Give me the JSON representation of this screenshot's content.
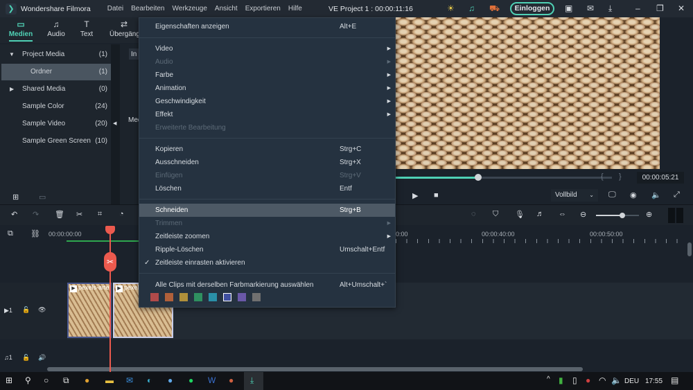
{
  "titlebar": {
    "app_name": "Wondershare Filmora",
    "menus": [
      "Datei",
      "Bearbeiten",
      "Werkzeuge",
      "Ansicht",
      "Exportieren",
      "Hilfe"
    ],
    "project_title": "VE Project 1 : 00:00:11:16",
    "login_label": "Einloggen"
  },
  "tabs": [
    {
      "label": "Medien",
      "icon": "folder-icon",
      "active": true
    },
    {
      "label": "Audio",
      "icon": "music-note-icon"
    },
    {
      "label": "Text",
      "icon": "text-icon"
    },
    {
      "label": "Übergäng",
      "icon": "transition-icon"
    }
  ],
  "media_tree": [
    {
      "label": "Project Media",
      "count": "(1)",
      "expanded": true
    },
    {
      "label": "Ordner",
      "count": "(1)",
      "selected": true
    },
    {
      "label": "Shared Media",
      "count": "(0)"
    },
    {
      "label": "Sample Color",
      "count": "(24)"
    },
    {
      "label": "Sample Video",
      "count": "(20)"
    },
    {
      "label": "Sample Green Screen",
      "count": "(10)"
    }
  ],
  "media_area": {
    "button_partial": "In",
    "label_partial": "Med"
  },
  "context_menu": {
    "items": [
      {
        "label": "Eigenschaften anzeigen",
        "shortcut": "Alt+E"
      },
      {
        "label": "Video",
        "submenu": true
      },
      {
        "label": "Audio",
        "submenu": true,
        "disabled": true
      },
      {
        "label": "Farbe",
        "submenu": true
      },
      {
        "label": "Animation",
        "submenu": true
      },
      {
        "label": "Geschwindigkeit",
        "submenu": true
      },
      {
        "label": "Effekt",
        "submenu": true
      },
      {
        "label": "Erweiterte Bearbeitung",
        "disabled": true
      },
      {
        "label": "Kopieren",
        "shortcut": "Strg+C"
      },
      {
        "label": "Ausschneiden",
        "shortcut": "Strg+X"
      },
      {
        "label": "Einfügen",
        "shortcut": "Strg+V",
        "disabled": true
      },
      {
        "label": "Löschen",
        "shortcut": "Entf"
      },
      {
        "label": "Schneiden",
        "shortcut": "Strg+B",
        "highlighted": true
      },
      {
        "label": "Trimmen",
        "submenu": true,
        "disabled": true
      },
      {
        "label": "Zeitleiste zoomen",
        "submenu": true
      },
      {
        "label": "Ripple-Löschen",
        "shortcut": "Umschalt+Entf"
      },
      {
        "label": "Zeitleiste einrasten aktivieren",
        "checked": true
      },
      {
        "label": "Alle Clips mit derselben Farbmarkierung auswählen",
        "shortcut": "Alt+Umschalt+`"
      }
    ],
    "color_swatches": [
      "#b04a4a",
      "#b0603a",
      "#b0903a",
      "#2f9060",
      "#2a90a8",
      "#4050a0",
      "#6a58a8",
      "#707070"
    ],
    "selected_swatch": 5
  },
  "preview": {
    "progress_percent": 38,
    "timecode": "00:00:05:21",
    "quality": "Vollbild",
    "brace_open": "{",
    "brace_close": "}"
  },
  "timeline": {
    "ruler_labels": [
      "00:00:00:00",
      "0:00",
      "00:00:40:00",
      "00:00:50:00"
    ],
    "clips": [
      {
        "name": "pexels-arte"
      },
      {
        "name": "pexels-arte"
      }
    ],
    "video_track": "1",
    "audio_track": "1"
  },
  "taskbar": {
    "language": "DEU",
    "time": "17:55"
  },
  "colors": {
    "accent": "#4fd1b5",
    "playhead": "#ec5a4e"
  }
}
